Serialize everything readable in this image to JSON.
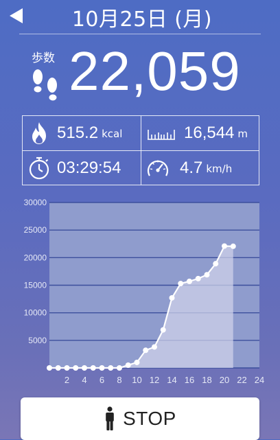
{
  "header": {
    "date": "10月25日 (月)",
    "back_icon": "back-arrow-icon"
  },
  "steps": {
    "label": "歩数",
    "value": "22,059",
    "icon": "footprints-icon"
  },
  "stats": {
    "calories": {
      "value": "515.2",
      "unit": "kcal",
      "icon": "flame-icon"
    },
    "distance": {
      "value": "16,544",
      "unit": "m",
      "icon": "ruler-icon"
    },
    "duration": {
      "value": "03:29:54",
      "icon": "stopwatch-icon"
    },
    "speed": {
      "value": "4.7",
      "unit": "km/h",
      "icon": "speedometer-icon"
    }
  },
  "chart_data": {
    "type": "area",
    "title": "",
    "xlabel": "",
    "ylabel": "",
    "x": [
      0,
      1,
      2,
      3,
      4,
      5,
      6,
      7,
      8,
      9,
      10,
      11,
      12,
      13,
      14,
      15,
      16,
      17,
      18,
      19,
      20,
      21
    ],
    "values": [
      0,
      0,
      0,
      0,
      0,
      0,
      0,
      0,
      0,
      500,
      1000,
      3200,
      3800,
      6900,
      12700,
      15300,
      15700,
      16200,
      16900,
      18900,
      22100,
      22059
    ],
    "xlim": [
      0,
      24
    ],
    "ylim": [
      0,
      30000
    ],
    "xticks": [
      "2",
      "4",
      "6",
      "8",
      "10",
      "12",
      "14",
      "16",
      "18",
      "20",
      "22",
      "24"
    ],
    "yticks": [
      "5000",
      "10000",
      "15000",
      "20000",
      "25000",
      "30000"
    ],
    "grid": true,
    "colors": {
      "line": "#ffffff",
      "fill": "#d0d3ea",
      "plot_bg": "#8f9ccd",
      "grid": "#3c4f9c"
    }
  },
  "stop_button": {
    "label": "STOP",
    "icon": "person-icon"
  }
}
